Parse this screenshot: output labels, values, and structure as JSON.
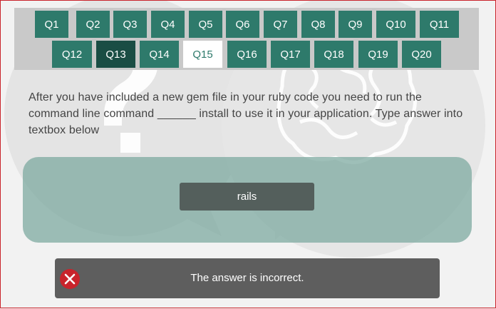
{
  "questions": [
    "Q1",
    "Q2",
    "Q3",
    "Q4",
    "Q5",
    "Q6",
    "Q7",
    "Q8",
    "Q9",
    "Q10",
    "Q11",
    "Q12",
    "Q13",
    "Q14",
    "Q15",
    "Q16",
    "Q17",
    "Q18",
    "Q19",
    "Q20"
  ],
  "active_question": "Q13",
  "current_question": "Q15",
  "question_text": "After you have included a new gem file in your ruby code you need to run the command line command ______ install to use it in your application. Type answer into textbox below",
  "answer_value": "rails",
  "feedback_text": "The answer is incorrect.",
  "feedback_icon": "error-x-icon",
  "colors": {
    "button": "#2e7a6b",
    "button_active": "#1a4d44",
    "error": "#c9232b"
  }
}
